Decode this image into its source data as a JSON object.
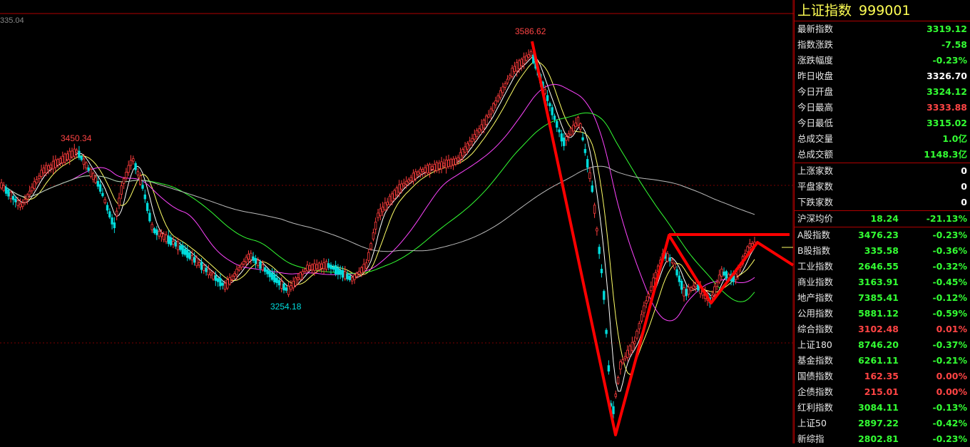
{
  "window": {
    "top_left_value": "335.04"
  },
  "chart": {
    "high_label": "3586.62",
    "left_high_label": "3450.34",
    "low_label": "3254.18",
    "colors": {
      "up": "#ff3c3c",
      "down": "#00dcdc",
      "ma5": "#ffffff",
      "ma10": "#ffff66",
      "ma30": "#ff44ff",
      "ma60": "#33ff33",
      "ma120": "#bbbbbb",
      "annotation": "#ff0000"
    }
  },
  "panel": {
    "title": "上证指数",
    "code": "999001",
    "quote": [
      {
        "label": "最新指数",
        "value": "3319.12",
        "color": "g"
      },
      {
        "label": "指数涨跌",
        "value": "-7.58",
        "color": "g"
      },
      {
        "label": "涨跌幅度",
        "value": "-0.23%",
        "color": "g"
      },
      {
        "label": "昨日收盘",
        "value": "3326.70",
        "color": "w"
      },
      {
        "label": "今日开盘",
        "value": "3324.12",
        "color": "g"
      },
      {
        "label": "今日最高",
        "value": "3333.88",
        "color": "r"
      },
      {
        "label": "今日最低",
        "value": "3315.02",
        "color": "g"
      },
      {
        "label": "总成交量",
        "value": "1.0亿",
        "color": "g"
      },
      {
        "label": "总成交额",
        "value": "1148.3亿",
        "color": "g"
      }
    ],
    "breadth": [
      {
        "label": "上涨家数",
        "value": "0"
      },
      {
        "label": "平盘家数",
        "value": "0"
      },
      {
        "label": "下跌家数",
        "value": "0"
      }
    ],
    "avg": {
      "label": "沪深均价",
      "value": "18.24",
      "pct": "-21.13%"
    },
    "indices": [
      {
        "label": "A股指数",
        "value": "3476.23",
        "pct": "-0.23%",
        "color": "g"
      },
      {
        "label": "B股指数",
        "value": "335.58",
        "pct": "-0.36%",
        "color": "g"
      },
      {
        "label": "工业指数",
        "value": "2646.55",
        "pct": "-0.32%",
        "color": "g"
      },
      {
        "label": "商业指数",
        "value": "3163.91",
        "pct": "-0.45%",
        "color": "g"
      },
      {
        "label": "地产指数",
        "value": "7385.41",
        "pct": "-0.12%",
        "color": "g"
      },
      {
        "label": "公用指数",
        "value": "5881.12",
        "pct": "-0.59%",
        "color": "g"
      },
      {
        "label": "综合指数",
        "value": "3102.48",
        "pct": "0.01%",
        "color": "r"
      },
      {
        "label": "上证180",
        "value": "8746.20",
        "pct": "-0.37%",
        "color": "g"
      },
      {
        "label": "基金指数",
        "value": "6261.11",
        "pct": "-0.21%",
        "color": "g"
      },
      {
        "label": "国债指数",
        "value": "162.35",
        "pct": "0.00%",
        "color": "r"
      },
      {
        "label": "企债指数",
        "value": "215.01",
        "pct": "0.00%",
        "color": "r"
      },
      {
        "label": "红利指数",
        "value": "3084.11",
        "pct": "-0.13%",
        "color": "g"
      },
      {
        "label": "上证50",
        "value": "2897.22",
        "pct": "-0.42%",
        "color": "g"
      },
      {
        "label": "新综指",
        "value": "2802.81",
        "pct": "-0.23%",
        "color": "g"
      }
    ]
  }
}
